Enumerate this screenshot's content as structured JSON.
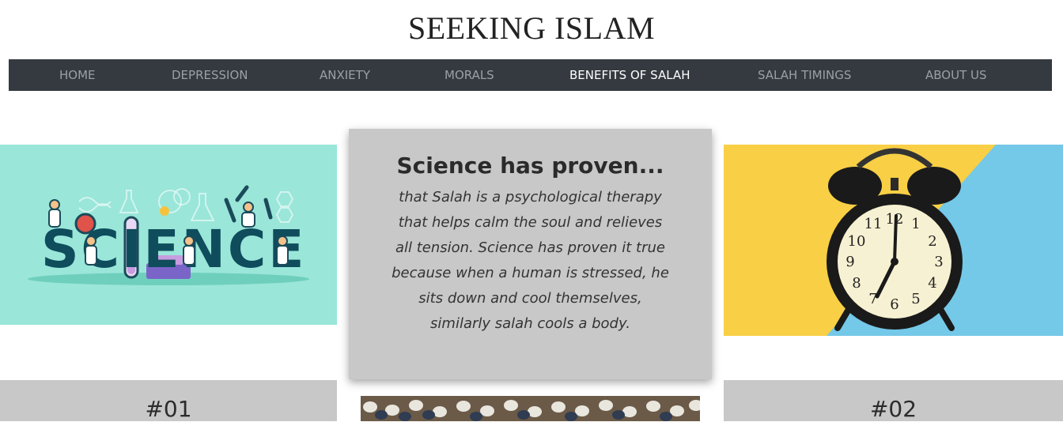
{
  "site": {
    "title": "SEEKING ISLAM"
  },
  "nav": {
    "items": [
      {
        "label": "HOME",
        "active": false
      },
      {
        "label": "DEPRESSION",
        "active": false
      },
      {
        "label": "ANXIETY",
        "active": false
      },
      {
        "label": "MORALS",
        "active": false
      },
      {
        "label": "BENEFITS OF SALAH",
        "active": true
      },
      {
        "label": "SALAH TIMINGS",
        "active": false
      },
      {
        "label": "ABOUT US",
        "active": false
      }
    ]
  },
  "science_image": {
    "text": "SCIENCE"
  },
  "clock_image": {
    "numerals": [
      "12",
      "1",
      "2",
      "3",
      "4",
      "5",
      "6",
      "7",
      "8",
      "9",
      "10",
      "11"
    ]
  },
  "card": {
    "heading": "Science has proven...",
    "body": "that Salah is a psychological therapy that helps calm the soul and relieves all tension. Science has proven it true because when a human is stressed, he sits down and cool themselves, similarly salah cools a body."
  },
  "sections": {
    "left_label": "#01",
    "right_label": "#02"
  },
  "colors": {
    "navbar": "#343a40",
    "card": "#c8c8c8",
    "science_bg": "#9ae6d9",
    "clock_yellow": "#f8cf45",
    "clock_blue": "#74c8e8"
  }
}
